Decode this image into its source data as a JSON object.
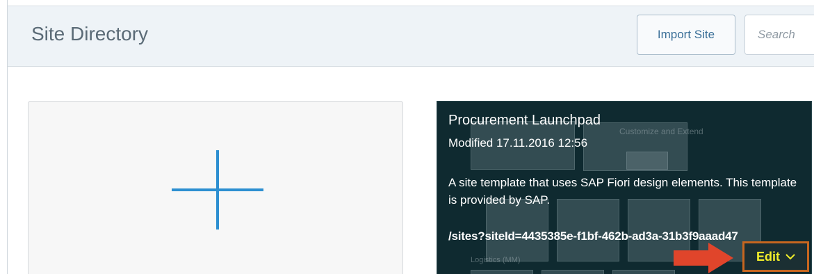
{
  "header": {
    "title": "Site Directory",
    "import_label": "Import Site",
    "search_placeholder": "Search"
  },
  "tiles": {
    "add": {
      "icon": "plus-icon"
    },
    "site": {
      "name": "Procurement Launchpad",
      "modified": "Modified 17.11.2016 12:56",
      "description": "A site template that uses SAP Fiori design elements. This template is provided by SAP.",
      "url": "/sites?siteId=4435385e-f1bf-462b-ad3a-31b3f9aaad47",
      "edit_label": "Edit",
      "background_text": {
        "customize": "Customize and Extend",
        "logistics": "Logistics (MM)"
      }
    }
  },
  "annotation": {
    "arrow_color": "#e0452b",
    "highlight_color": "#c7661f"
  },
  "colors": {
    "accent": "#2d8fd1",
    "tile_dark": "#0f2a30",
    "edit_text": "#f3ef2a"
  }
}
